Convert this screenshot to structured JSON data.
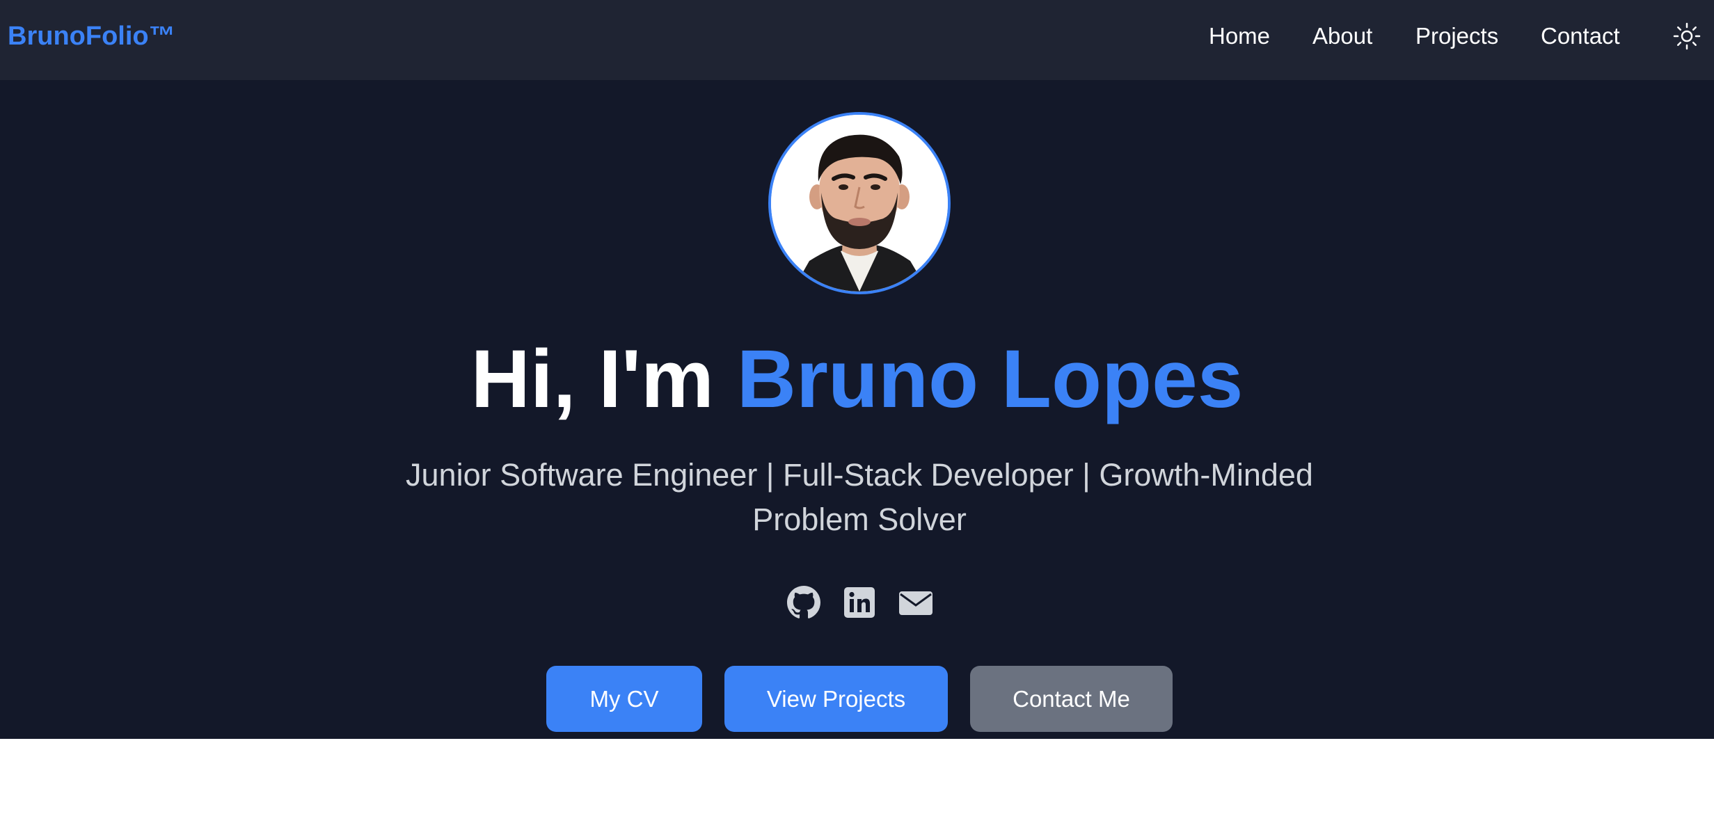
{
  "nav": {
    "brand": "BrunoFolio™",
    "links": [
      "Home",
      "About",
      "Projects",
      "Contact"
    ],
    "theme_toggle_icon": "sun-icon"
  },
  "hero": {
    "avatar_alt": "profile-photo",
    "headline_intro": "Hi, I'm ",
    "headline_name": "Bruno Lopes",
    "tagline": "Junior Software Engineer | Full-Stack Developer | Growth-Minded Problem Solver",
    "social_icons": [
      "github-icon",
      "linkedin-icon",
      "email-icon"
    ],
    "buttons": {
      "cv": "My CV",
      "projects": "View Projects",
      "contact": "Contact Me"
    }
  },
  "colors": {
    "nav_bg": "#1f2433",
    "hero_bg": "#131829",
    "accent": "#3b82f6",
    "secondary_button": "#6b7280"
  }
}
